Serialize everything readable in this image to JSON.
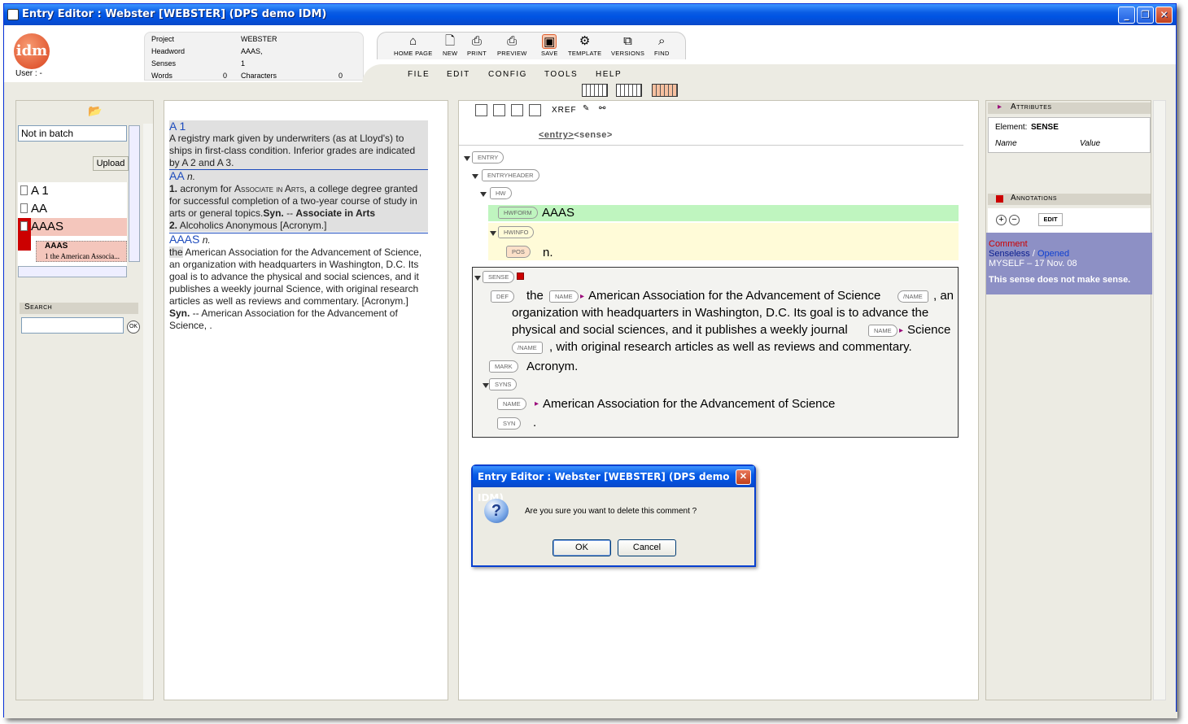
{
  "window": {
    "title": "Entry Editor : Webster [WEBSTER] (DPS demo IDM)"
  },
  "header": {
    "logo_text": "idm",
    "user_label": "User : -",
    "info": {
      "project_label": "Project",
      "project_value": "WEBSTER",
      "headword_label": "Headword",
      "headword_value": "AAAS,",
      "senses_label": "Senses",
      "senses_value": "1",
      "words_label": "Words",
      "words_value": "0",
      "characters_label": "Characters",
      "characters_value": "0"
    },
    "tools": [
      {
        "label": "HOME PAGE",
        "icon": "home-icon"
      },
      {
        "label": "NEW",
        "icon": "new-document-icon"
      },
      {
        "label": "PRINT",
        "icon": "printer-icon"
      },
      {
        "label": "PREVIEW",
        "icon": "print-preview-icon"
      },
      {
        "label": "SAVE",
        "icon": "save-icon"
      },
      {
        "label": "TEMPLATE",
        "icon": "template-icon"
      },
      {
        "label": "VERSIONS",
        "icon": "versions-icon"
      },
      {
        "label": "FIND",
        "icon": "find-icon"
      }
    ],
    "menus": [
      "FILE",
      "EDIT",
      "CONFIG",
      "TOOLS",
      "HELP"
    ]
  },
  "left": {
    "batch_select": "Not in batch",
    "upload_label": "Upload",
    "entries": [
      "A 1",
      "AA",
      "AAAS"
    ],
    "sub_entry_title": "AAAS",
    "sub_entry_text": "1 the American Associa...",
    "search_label": "Search",
    "search_ok": "OK"
  },
  "preview": {
    "e1_hw": "A 1",
    "e1_def": "A registry mark given by underwriters (as at Lloyd's) to ships in first-class condition. Inferior grades are indicated by A 2 and A 3.",
    "e2_hw": "AA",
    "e2_pos": "n.",
    "e2_s1_num": "1.",
    "e2_s1_a": " acronym for ",
    "e2_s1_sc": "Associate in Arts",
    "e2_s1_b": ", a college degree granted for successful completion of a two-year course of study in arts or general topics.",
    "e2_s1_syn": "Syn.",
    "e2_s1_c": " -- ",
    "e2_s1_bold": "Associate in Arts",
    "e2_s2_num": "2.",
    "e2_s2_text": " Alcoholics Anonymous [Acronym.]",
    "e3_hw": "AAAS",
    "e3_pos": "n.",
    "e3_the": "the",
    "e3_def": " American Association for the Advancement of Science, an organization with headquarters in Washington, D.C. Its goal is to advance the physical and social sciences, and it publishes a weekly journal Science, with original research articles as well as reviews and commentary. [Acronym.]",
    "e3_syn": "Syn.",
    "e3_syn_text": " -- American Association for the Advancement of Science, ."
  },
  "editor": {
    "xref_label": "XREF",
    "path_entry": "<entry>",
    "path_sense": "<sense>",
    "tags": {
      "entry": "ENTRY",
      "entryheader": "ENTRYHEADER",
      "hw": "HW",
      "hwform": "HWFORM",
      "hwinfo": "HWINFO",
      "pos": "POS",
      "sense": "SENSE",
      "def": "DEF",
      "name": "NAME",
      "name_close": "/NAME",
      "mark": "MARK",
      "syns": "SYNS",
      "syn": "SYN"
    },
    "hwform_text": "AAAS",
    "pos_text": "n.",
    "def_the": "the",
    "def_name1": "American Association for the Advancement of Science",
    "def_after1": ", an",
    "def_line2": "organization with headquarters in Washington, D.C. Its goal is to advance the",
    "def_line3": "physical and social sciences, and it publishes a weekly journal",
    "def_name2": "Science",
    "def_line4": ", with original research articles as well as reviews and commentary.",
    "mark_text": "Acronym.",
    "syn_name": "American Association for the Advancement of Science",
    "syn_text": "."
  },
  "right": {
    "attributes_label": "Attributes",
    "element_label": "Element:",
    "element_value": "SENSE",
    "col_name": "Name",
    "col_value": "Value",
    "annotations_label": "Annotations",
    "edit_label": "EDIT",
    "comment_label": "Comment",
    "status_a": "Senseless",
    "status_sep": " / ",
    "status_b": "Opened",
    "author_line": "MYSELF  –  17 Nov. 08",
    "comment_text": "This sense does not make sense."
  },
  "dialog": {
    "title": "Entry Editor : Webster [WEBSTER] (DPS demo IDM)",
    "message": "Are you sure you want to delete this comment ?",
    "ok": "OK",
    "cancel": "Cancel"
  },
  "colors": {
    "title_blue": "#0054e3",
    "accent_orange": "#d9421c",
    "headword_blue": "#1c4bbd",
    "hwform_green": "#bff5bf",
    "comment_bg": "#8d90c5",
    "selected_red": "#cc0000"
  }
}
